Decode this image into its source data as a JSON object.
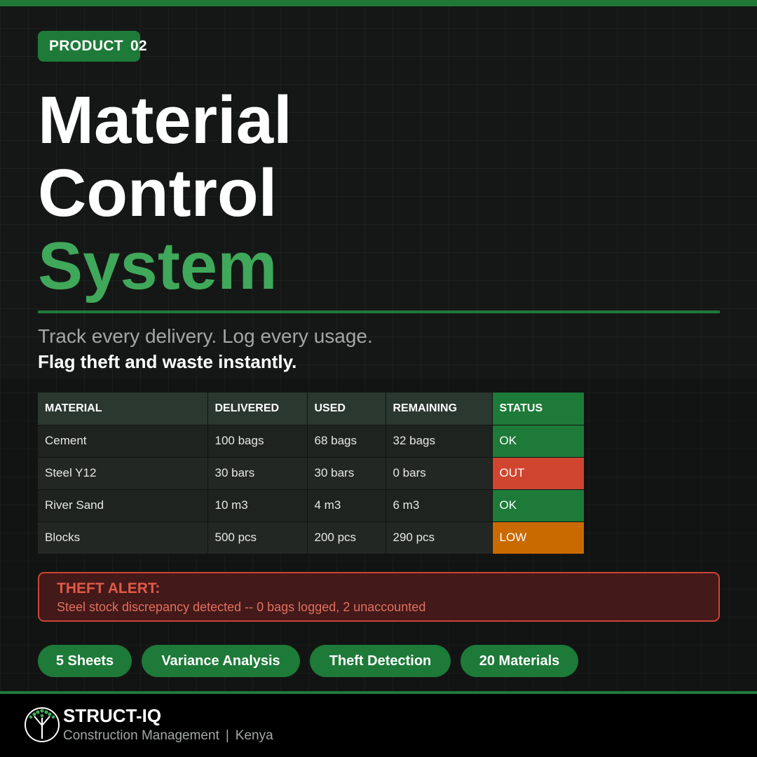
{
  "badge": {
    "label": "PRODUCT",
    "number": "02"
  },
  "headline": {
    "line1": "Material",
    "line2": "Control",
    "line3": "System"
  },
  "subtitle": {
    "line1": "Track every delivery. Log every usage.",
    "line2": "Flag theft and waste instantly."
  },
  "table": {
    "headers": [
      "MATERIAL",
      "DELIVERED",
      "USED",
      "REMAINING",
      "STATUS"
    ],
    "rows": [
      [
        "Cement",
        "100 bags",
        "68 bags",
        "32 bags",
        "OK"
      ],
      [
        "Steel Y12",
        "30 bars",
        "30 bars",
        "0 bars",
        "OUT"
      ],
      [
        "River Sand",
        "10 m3",
        "4 m3",
        "6 m3",
        "OK"
      ],
      [
        "Blocks",
        "500 pcs",
        "200 pcs",
        "290 pcs",
        "LOW"
      ]
    ]
  },
  "alert": {
    "title": "THEFT ALERT:",
    "message": "Steel stock discrepancy detected -- 0 bags logged, 2 unaccounted"
  },
  "pills": [
    "5 Sheets",
    "Variance Analysis",
    "Theft Detection",
    "20 Materials"
  ],
  "footer": {
    "brand": "STRUCT-IQ",
    "tagline_left": "Construction Management",
    "separator": "|",
    "tagline_right": "Kenya",
    "logo_icon": "tree-logo-icon"
  },
  "colors": {
    "accent": "#1d7a38",
    "accent_light": "#3fa85a",
    "status_ok": "#1d7a38",
    "status_out": "#cf4530",
    "status_low": "#c96a00",
    "alert_text": "#e25a46"
  }
}
